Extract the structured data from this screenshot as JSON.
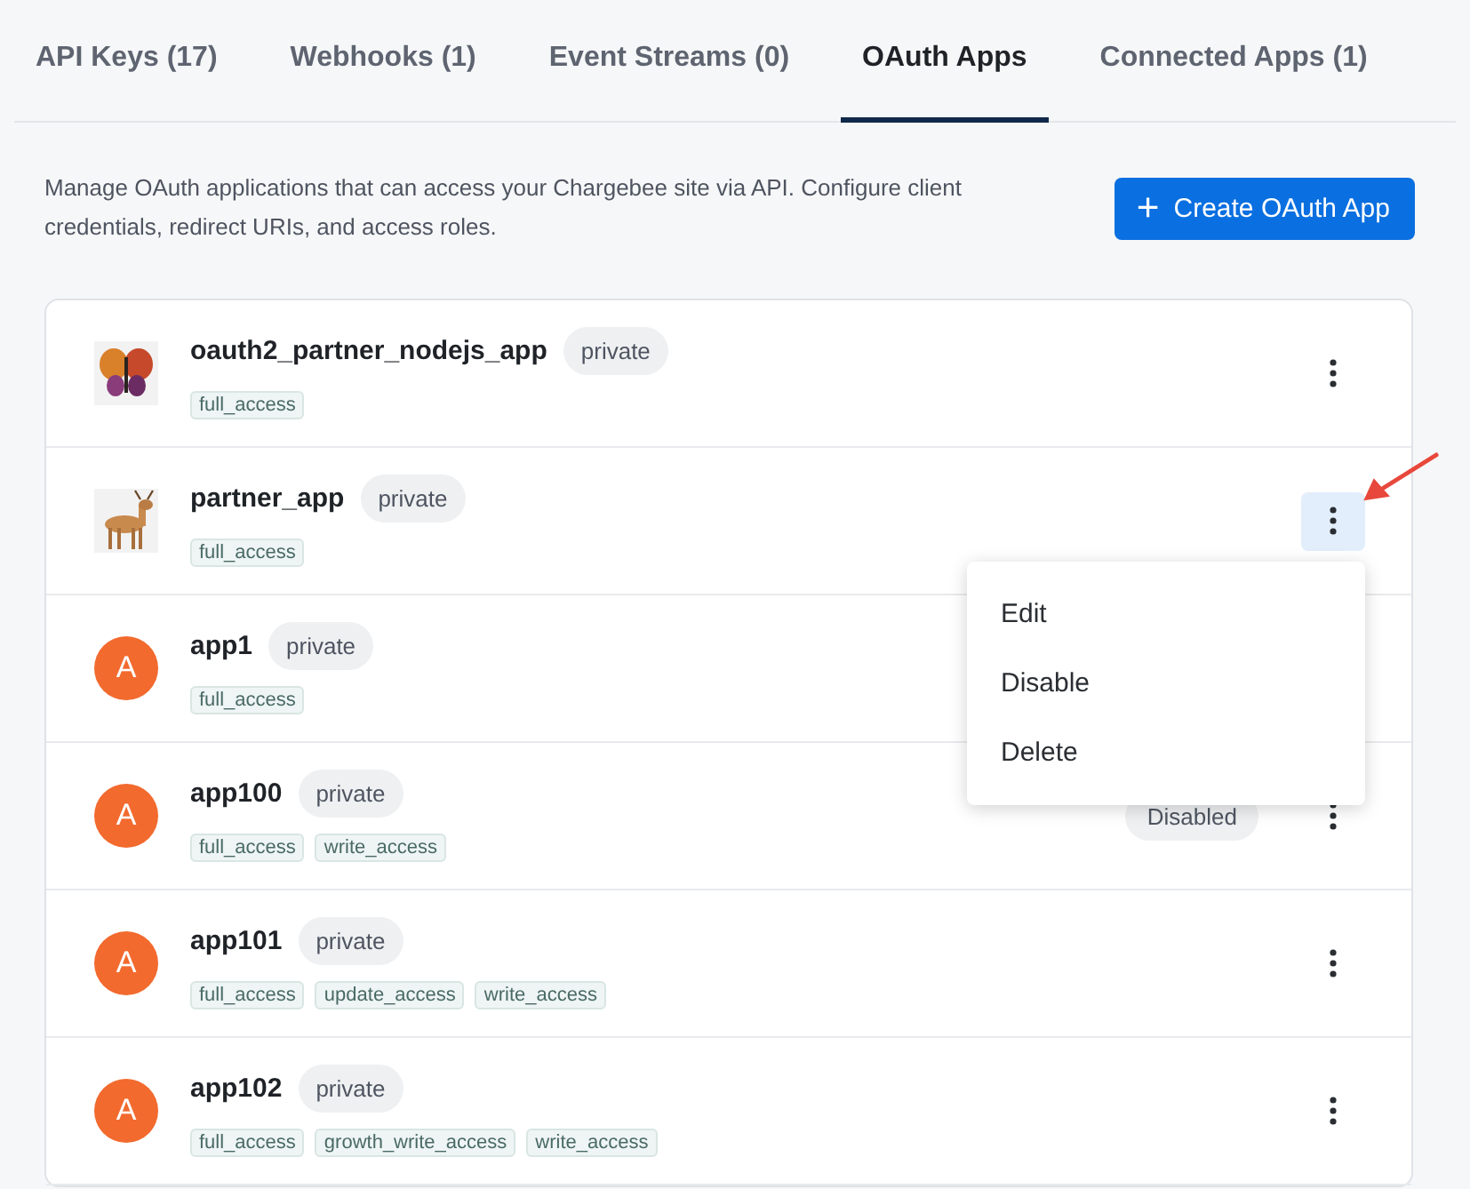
{
  "tabs": [
    {
      "label": "API Keys (17)",
      "selected": false
    },
    {
      "label": "Webhooks (1)",
      "selected": false
    },
    {
      "label": "Event Streams (0)",
      "selected": false
    },
    {
      "label": "OAuth Apps",
      "selected": true
    },
    {
      "label": "Connected Apps (1)",
      "selected": false
    }
  ],
  "description": "Manage OAuth applications that can access your Chargebee site via API. Configure client credentials, redirect URIs, and access roles.",
  "create_button": {
    "icon": "+",
    "label": "Create OAuth App"
  },
  "apps": [
    {
      "name": "oauth2_partner_nodejs_app",
      "visibility": "private",
      "icon": {
        "kind": "picture"
      },
      "scopes": [
        "full_access"
      ],
      "menu_open": false
    },
    {
      "name": "partner_app",
      "visibility": "private",
      "icon": {
        "kind": "picture"
      },
      "scopes": [
        "full_access"
      ],
      "menu_open": true
    },
    {
      "name": "app1",
      "visibility": "private",
      "icon": {
        "kind": "avatar",
        "letter": "A"
      },
      "scopes": [
        "full_access"
      ],
      "menu_open": false
    },
    {
      "name": "app100",
      "visibility": "private",
      "icon": {
        "kind": "avatar",
        "letter": "A"
      },
      "scopes": [
        "full_access",
        "write_access"
      ],
      "status": "Disabled",
      "menu_open": false
    },
    {
      "name": "app101",
      "visibility": "private",
      "icon": {
        "kind": "avatar",
        "letter": "A"
      },
      "scopes": [
        "full_access",
        "update_access",
        "write_access"
      ],
      "menu_open": false
    },
    {
      "name": "app102",
      "visibility": "private",
      "icon": {
        "kind": "avatar",
        "letter": "A"
      },
      "scopes": [
        "full_access",
        "growth_write_access",
        "write_access"
      ],
      "menu_open": false
    }
  ],
  "row_menu": [
    "Edit",
    "Disable",
    "Delete"
  ]
}
